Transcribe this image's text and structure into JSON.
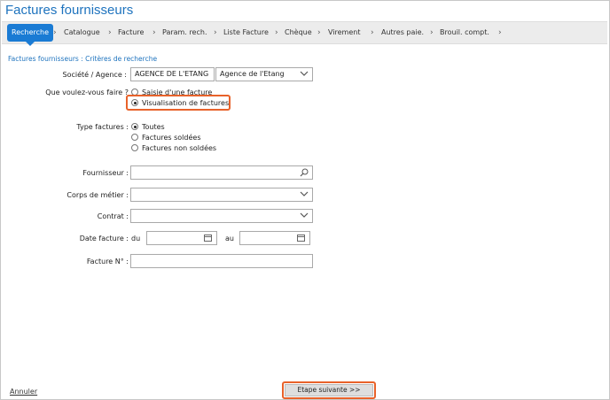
{
  "app": {
    "title": "Factures fournisseurs"
  },
  "breadcrumb": {
    "items": [
      {
        "label": "Recherche",
        "active": true
      },
      {
        "label": "Catalogue"
      },
      {
        "label": "Facture"
      },
      {
        "label": "Param. rech."
      },
      {
        "label": "Liste Facture"
      },
      {
        "label": "Chèque"
      },
      {
        "label": "Virement"
      },
      {
        "label": "Autres paie."
      },
      {
        "label": "Brouil. compt."
      }
    ],
    "separator": "›"
  },
  "section": {
    "title": "Factures fournisseurs : Critères de recherche"
  },
  "form": {
    "societe": {
      "label": "Société / Agence :",
      "code": "AGENCE DE L'ETANG",
      "name": "Agence de l'Etang"
    },
    "action": {
      "label": "Que voulez-vous faire ?",
      "options": [
        {
          "label": "Saisie d'une facture",
          "selected": false
        },
        {
          "label": "Visualisation de factures",
          "selected": true
        }
      ]
    },
    "type": {
      "label": "Type factures :",
      "options": [
        {
          "label": "Toutes",
          "selected": true
        },
        {
          "label": "Factures soldées",
          "selected": false
        },
        {
          "label": "Factures non soldées",
          "selected": false
        }
      ]
    },
    "fournisseur": {
      "label": "Fournisseur :",
      "value": ""
    },
    "corps_metier": {
      "label": "Corps de métier :",
      "value": ""
    },
    "contrat": {
      "label": "Contrat :",
      "value": ""
    },
    "date": {
      "label": "Date facture :",
      "from_label": "du",
      "to_label": "au",
      "from": "",
      "to": ""
    },
    "numero": {
      "label": "Facture N° :",
      "value": ""
    }
  },
  "footer": {
    "cancel_label": "Annuler",
    "next_label": "Etape suivante >>"
  },
  "colors": {
    "accent": "#1a7bd4",
    "highlight": "#e8622a",
    "title": "#1e73be"
  }
}
